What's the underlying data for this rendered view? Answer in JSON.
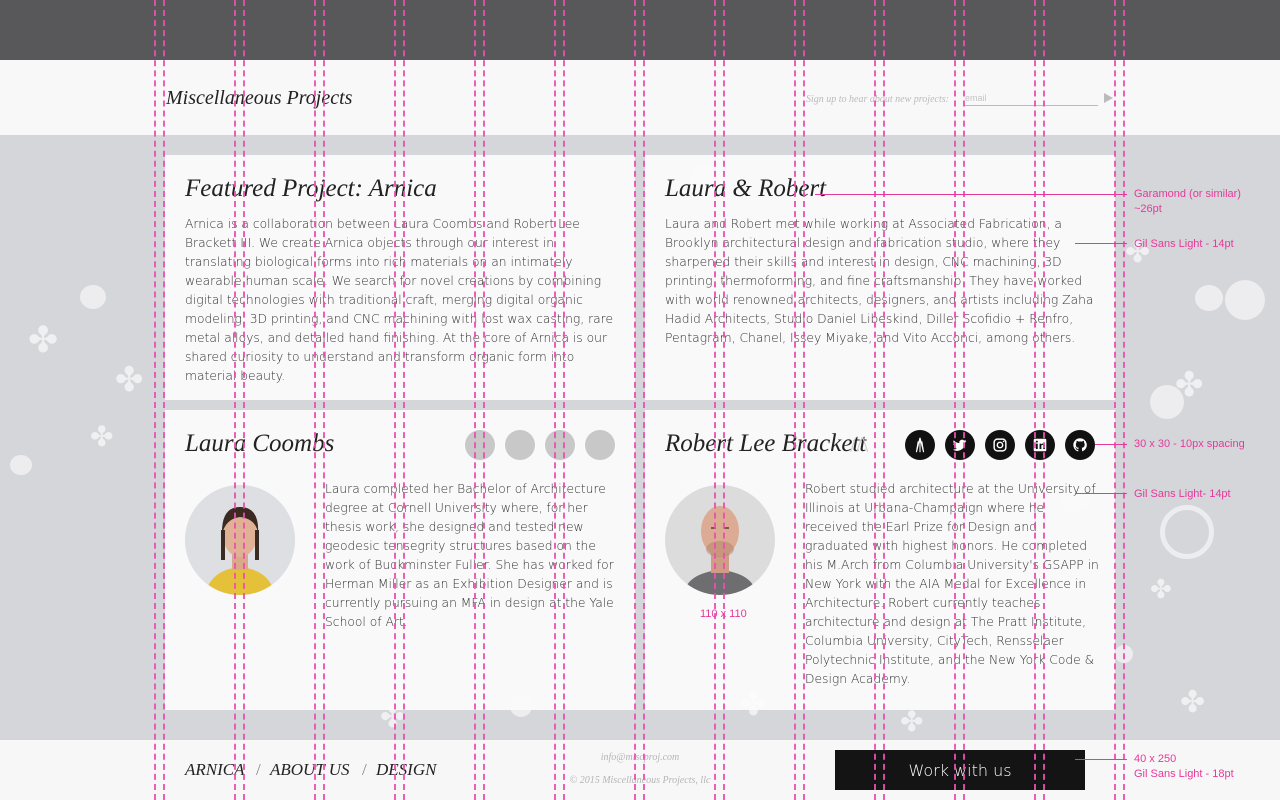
{
  "header": {
    "brand": "Miscellaneous Projects",
    "signup_text": "Sign up to hear about new projects:",
    "email_placeholder": "email"
  },
  "featured": {
    "title": "Featured Project: Arnica",
    "body": "Arnica is a collaboration between Laura Coombs and Robert Lee Brackett III. We create Arnica objects through our interest in translating biological forms into rich materials on an intimately wearable human scale.  We search for novel creations by combining digital technologies with traditional craft, merging digital organic modeling, 3D printing, and CNC machining with lost wax casting, rare metal alloys, and detailed hand finishing.  At the core of Arnica is our shared curiosity to understand and transform organic form into material beauty."
  },
  "couple": {
    "title": "Laura & Robert",
    "body": "Laura and Robert met while working at Associated Fabrication, a Brooklyn architectural design and fabrication studio, where they sharpened their skills and interest in design, CNC machining, 3D printing, thermoforming, and fine craftsmanship. They have worked with world renowned architects, designers, and artists including Zaha Hadid Architects, Studio Daniel Libeskind, Diller Scofidio + Renfro, Pentagram, Chanel, Issey Miyake, and Vito Acconci, among others."
  },
  "laura": {
    "name": "Laura Coombs",
    "bio": "Laura completed her Bachelor of Architecture degree at Cornell University where, for her thesis work, she designed and tested new geodesic tensegrity structures based on the work of Buckminster Fuller.  She has worked for Herman Miller as an Exhibition Designer and is currently pursuing an MFA in design at the Yale School of Art."
  },
  "robert": {
    "name": "Robert Lee Brackett",
    "name_suffix": "//\\",
    "bio": "Robert studied architecture at the University of Illinois at Urbana-Champaign where he received the Earl Prize for Design and graduated with highest honors.  He completed his M.Arch from Columbia University's GSAPP in New York with the AIA Medal for Excellence in Architecture.  Robert currently teaches architecture and design at The Pratt Institute, Columbia University, CityTech, Rensselaer Polytechnic Institute, and the New York Code & Design Academy.",
    "social_icons": [
      "arnica-logo-icon",
      "twitter-icon",
      "instagram-icon",
      "linkedin-icon",
      "github-icon"
    ]
  },
  "footer": {
    "links": [
      "ARNICA",
      "ABOUT US",
      "DESIGN"
    ],
    "separator": "/",
    "email": "info@miscproj.com",
    "copyright": "© 2015 Miscellaneous Projects, llc",
    "cta": "Work with us"
  },
  "annotations": {
    "title_font": "Garamond (or similar)\n~26pt",
    "body_font": "Gil Sans Light - 14pt",
    "icon_spec": "30 x 30  - 10px spacing",
    "bio_font": "Gil Sans  Light- 14pt",
    "button_spec": "40 x 250\nGil Sans Light - 18pt",
    "avatar_size": "110 x 110"
  },
  "colors": {
    "annotation": "#e6399b",
    "button": "#141414",
    "topbar": "#58585a"
  }
}
